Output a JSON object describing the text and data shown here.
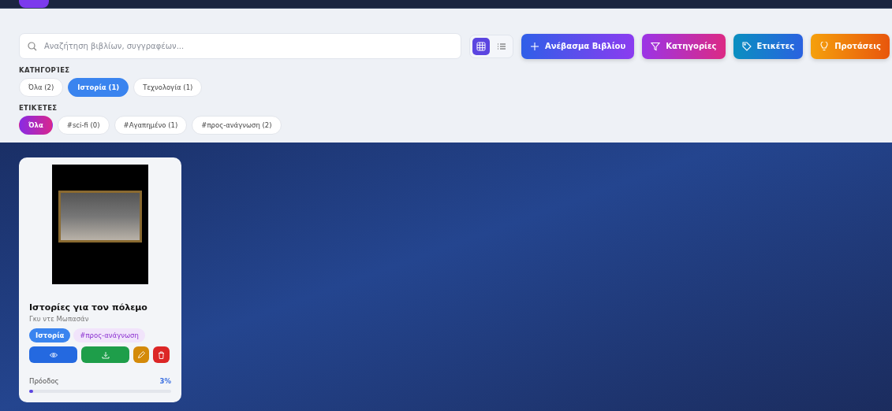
{
  "search": {
    "placeholder": "Αναζήτηση βιβλίων, συγγραφέων..."
  },
  "view_toggle": [
    {
      "kind": "grid",
      "selected": true
    },
    {
      "kind": "list",
      "selected": false
    }
  ],
  "actions": [
    {
      "label": "Ανέβασμα Βιβλίου",
      "kind": "upload"
    },
    {
      "label": "Κατηγορίες",
      "kind": "categories"
    },
    {
      "label": "Ετικέτες",
      "kind": "tags"
    },
    {
      "label": "Προτάσεις",
      "kind": "suggestions"
    }
  ],
  "categories": {
    "heading": "ΚΑΤΗΓΟΡΊΕΣ",
    "items": [
      {
        "label": "Όλα (2)",
        "selected": false
      },
      {
        "label": "Ιστορία (1)",
        "selected": true
      },
      {
        "label": "Τεχνολογία (1)",
        "selected": false
      }
    ]
  },
  "tags": {
    "heading": "ΕΤΙΚΈΤΕΣ",
    "items": [
      {
        "label": "Όλα",
        "selected": true
      },
      {
        "label": "#sci-fi (0)",
        "selected": false
      },
      {
        "label": "#Αγαπημένο (1)",
        "selected": false
      },
      {
        "label": "#προς-ανάγνωση (2)",
        "selected": false
      }
    ]
  },
  "books": [
    {
      "title": "Ιστορίες για τον πόλεμο",
      "author": "Γκυ ντε Μωπασάν",
      "category": "Ιστορία",
      "tag": "#προς-ανάγνωση",
      "progress_label": "Πρόοδος",
      "progress_text": "3%",
      "level": 0.03
    }
  ]
}
